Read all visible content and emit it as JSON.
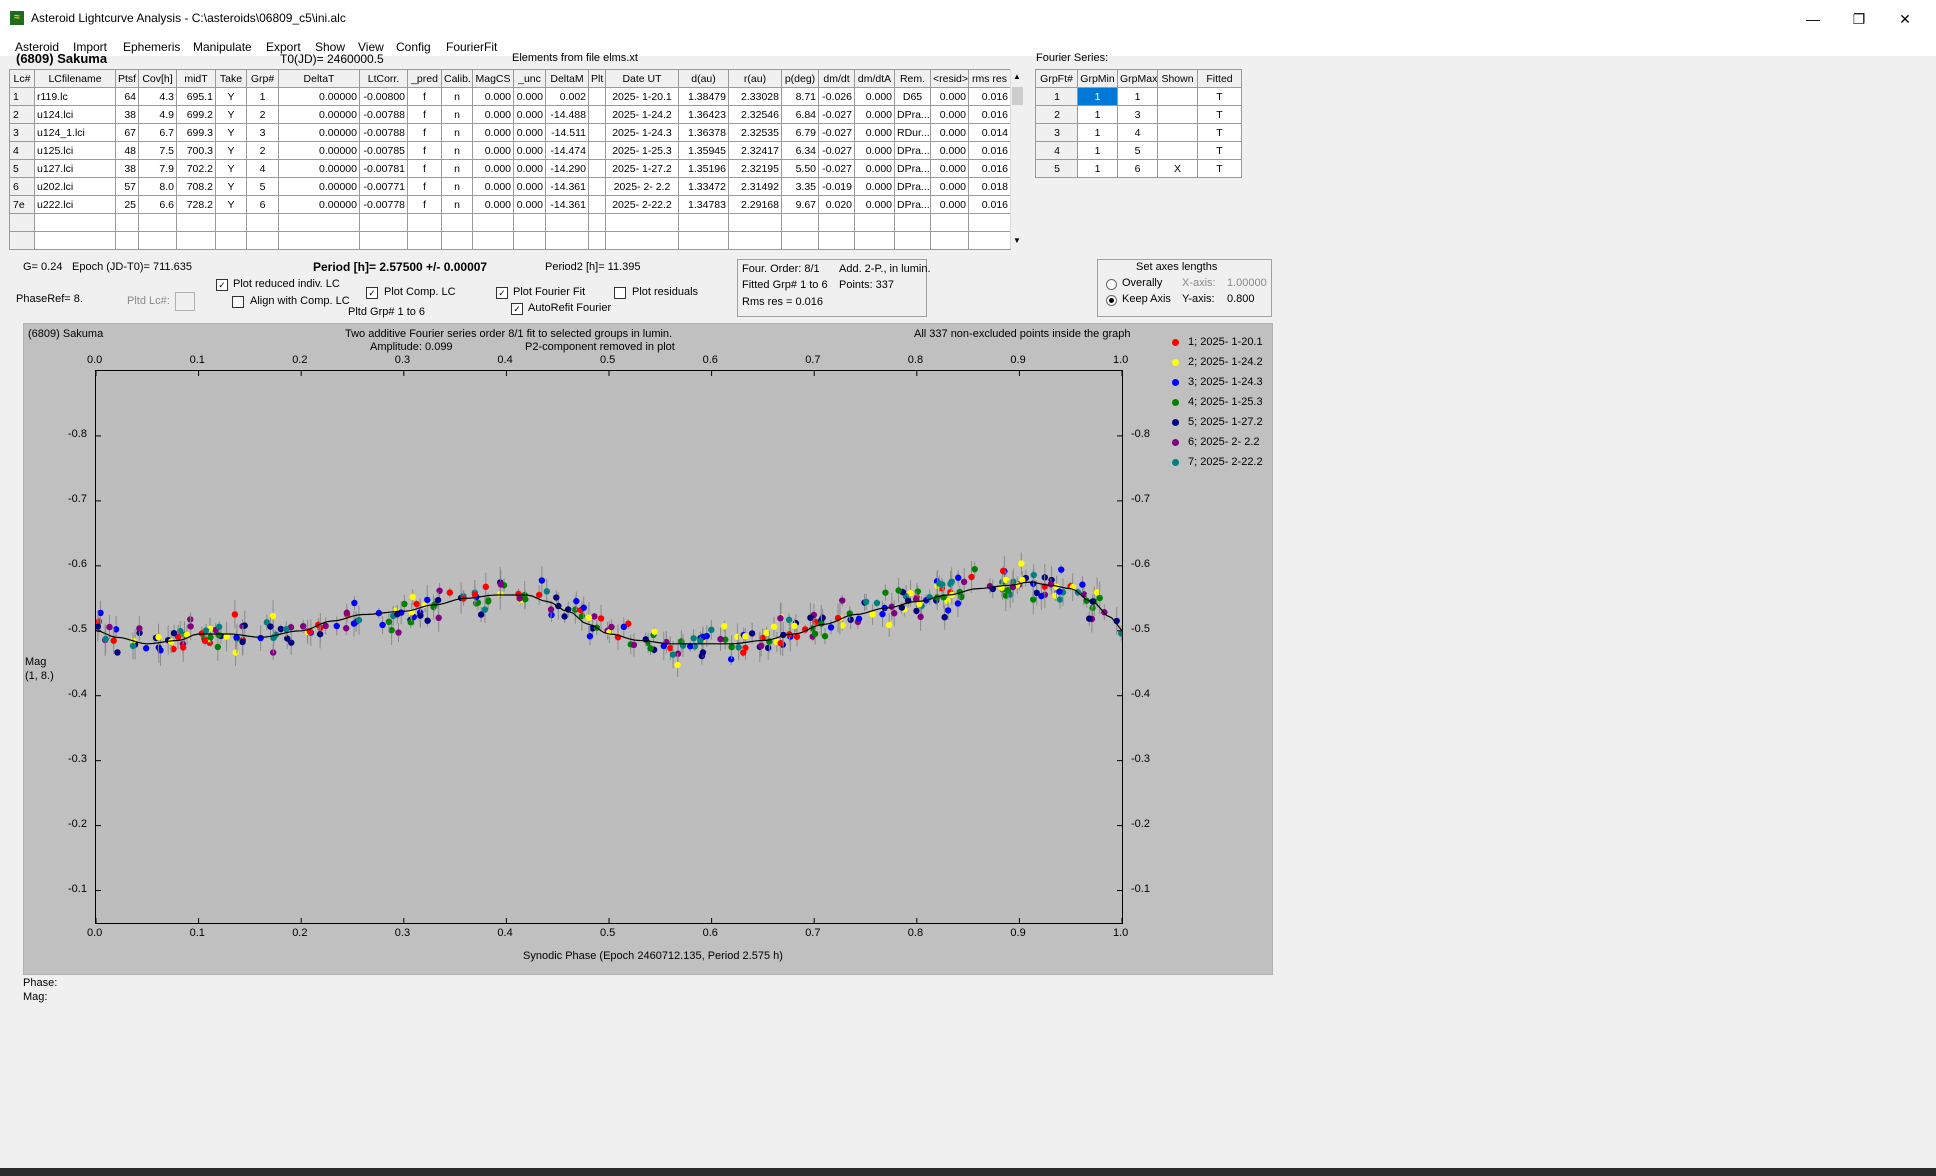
{
  "window": {
    "title": "Asteroid Lightcurve Analysis - C:\\asteroids\\06809_c5\\ini.alc",
    "minimize": "—",
    "maximize": "❐",
    "close": "✕"
  },
  "menu": [
    "Asteroid",
    "Import",
    "Ephemeris",
    "Manipulate",
    "Export",
    "Show",
    "View",
    "Config",
    "FourierFit"
  ],
  "header": {
    "asteroid": "(6809) Sakuma",
    "t0": "T0(JD)= 2460000.5",
    "elements": "Elements from file elms.xt"
  },
  "lc_table": {
    "columns": [
      "Lc#",
      "LCfilename",
      "Ptsf",
      "Cov[h]",
      "midT",
      "Take",
      "Grp#",
      "DeltaT",
      "LtCorr.",
      "_pred",
      "Calib.",
      "MagCS",
      "_unc",
      "DeltaM",
      "Plt",
      "Date UT",
      "d(au)",
      "r(au)",
      "p(deg)",
      "dm/dt",
      "dm/dtA",
      "Rem.",
      "<resid>",
      "rms res"
    ],
    "rows": [
      [
        "1",
        "r119.lc",
        "64",
        "4.3",
        "695.1",
        "Y",
        "1",
        "0.00000",
        "-0.00800",
        "f",
        "n",
        "0.000",
        "0.000",
        "0.002",
        "",
        "2025- 1-20.1",
        "1.38479",
        "2.33028",
        "8.71",
        "-0.026",
        "0.000",
        "D65",
        "0.000",
        "0.016"
      ],
      [
        "2",
        "u124.lci",
        "38",
        "4.9",
        "699.2",
        "Y",
        "2",
        "0.00000",
        "-0.00788",
        "f",
        "n",
        "0.000",
        "0.000",
        "-14.488",
        "",
        "2025- 1-24.2",
        "1.36423",
        "2.32546",
        "6.84",
        "-0.027",
        "0.000",
        "DPra...",
        "0.000",
        "0.016"
      ],
      [
        "3",
        "u124_1.lci",
        "67",
        "6.7",
        "699.3",
        "Y",
        "3",
        "0.00000",
        "-0.00788",
        "f",
        "n",
        "0.000",
        "0.000",
        "-14.511",
        "",
        "2025- 1-24.3",
        "1.36378",
        "2.32535",
        "6.79",
        "-0.027",
        "0.000",
        "RDur...",
        "0.000",
        "0.014"
      ],
      [
        "4",
        "u125.lci",
        "48",
        "7.5",
        "700.3",
        "Y",
        "2",
        "0.00000",
        "-0.00785",
        "f",
        "n",
        "0.000",
        "0.000",
        "-14.474",
        "",
        "2025- 1-25.3",
        "1.35945",
        "2.32417",
        "6.34",
        "-0.027",
        "0.000",
        "DPra...",
        "0.000",
        "0.016"
      ],
      [
        "5",
        "u127.lci",
        "38",
        "7.9",
        "702.2",
        "Y",
        "4",
        "0.00000",
        "-0.00781",
        "f",
        "n",
        "0.000",
        "0.000",
        "-14.290",
        "",
        "2025- 1-27.2",
        "1.35196",
        "2.32195",
        "5.50",
        "-0.027",
        "0.000",
        "DPra...",
        "0.000",
        "0.016"
      ],
      [
        "6",
        "u202.lci",
        "57",
        "8.0",
        "708.2",
        "Y",
        "5",
        "0.00000",
        "-0.00771",
        "f",
        "n",
        "0.000",
        "0.000",
        "-14.361",
        "",
        "2025- 2- 2.2",
        "1.33472",
        "2.31492",
        "3.35",
        "-0.019",
        "0.000",
        "DPra...",
        "0.000",
        "0.018"
      ],
      [
        "7e",
        "u222.lci",
        "25",
        "6.6",
        "728.2",
        "Y",
        "6",
        "0.00000",
        "-0.00778",
        "f",
        "n",
        "0.000",
        "0.000",
        "-14.361",
        "",
        "2025- 2-22.2",
        "1.34783",
        "2.29168",
        "9.67",
        "0.020",
        "0.000",
        "DPra...",
        "0.000",
        "0.016"
      ]
    ]
  },
  "fourier_table": {
    "title": "Fourier Series:",
    "columns": [
      "GrpFt#",
      "GrpMin",
      "GrpMax",
      "Shown",
      "Fitted"
    ],
    "rows": [
      [
        "1",
        "1",
        "1",
        "",
        "T"
      ],
      [
        "2",
        "1",
        "3",
        "",
        "T"
      ],
      [
        "3",
        "1",
        "4",
        "",
        "T"
      ],
      [
        "4",
        "1",
        "5",
        "",
        "T"
      ],
      [
        "5",
        "1",
        "6",
        "X",
        "T"
      ]
    ]
  },
  "controls": {
    "g": "G= 0.24",
    "epoch": "Epoch (JD-T0)= 711.635",
    "period": "Period [h]= 2.57500 +/- 0.00007",
    "period2": "Period2 [h]= 11.395",
    "phaseref": "PhaseRef= 8.",
    "pltd_lc": "Pltd Lc#:",
    "plot_reduced": "Plot reduced indiv. LC",
    "align_comp": "Align with Comp. LC",
    "plot_comp": "Plot Comp. LC",
    "pltd_grp": "Pltd Grp#  1   to   6",
    "plot_fourier": "Plot Fourier Fit",
    "autorefit": "AutoRefit Fourier",
    "plot_residuals": "Plot residuals",
    "four_order": "Four. Order:  8/1",
    "add2p": "Add. 2-P., in lumin.",
    "fitted_grp": "Fitted Grp# 1 to 6",
    "points": "Points:  337",
    "rms_res": "Rms res      = 0.016",
    "axes_title": "Set axes lengths",
    "overally": "Overally",
    "keep_axis": "Keep Axis",
    "xaxis_label": "X-axis:",
    "xaxis_val": "1.00000",
    "yaxis_label": "Y-axis:",
    "yaxis_val": "0.800",
    "checkmark": "✓"
  },
  "plot": {
    "name": "(6809) Sakuma",
    "line1": "Two additive Fourier series order 8/1 fit to selected groups in lumin.",
    "amplitude": "Amplitude: 0.099",
    "p2": "P2-component removed in plot",
    "inside": "All 337 non-excluded points inside the graph",
    "ylabel1": "Mag",
    "ylabel2": "(1, 8.)",
    "xlabel": "Synodic Phase (Epoch 2460712.135, Period 2.575 h)"
  },
  "status": {
    "phase": "Phase:",
    "mag": "Mag:"
  },
  "chart_data": {
    "type": "scatter",
    "x_ticks": [
      "0.0",
      "0.1",
      "0.2",
      "0.3",
      "0.4",
      "0.5",
      "0.6",
      "0.7",
      "0.8",
      "0.9",
      "1.0"
    ],
    "y_ticks": [
      "-0.8",
      "-0.7",
      "-0.6",
      "-0.5",
      "-0.4",
      "-0.3",
      "-0.2",
      "-0.1"
    ],
    "xlim": [
      0,
      1
    ],
    "ylim": [
      -0.9,
      -0.05
    ],
    "series": [
      {
        "name": "1; 2025- 1-20.1",
        "color": "#ff0000"
      },
      {
        "name": "2; 2025- 1-24.2",
        "color": "#ffff00"
      },
      {
        "name": "3; 2025- 1-24.3",
        "color": "#0000ff"
      },
      {
        "name": "4; 2025- 1-25.3",
        "color": "#008000"
      },
      {
        "name": "5; 2025- 1-27.2",
        "color": "#000080"
      },
      {
        "name": "6; 2025- 2- 2.2",
        "color": "#800080"
      },
      {
        "name": "7; 2025- 2-22.2",
        "color": "#008080"
      }
    ],
    "fit_curve": {
      "x": [
        0.0,
        0.02,
        0.05,
        0.08,
        0.1,
        0.13,
        0.16,
        0.2,
        0.23,
        0.26,
        0.3,
        0.33,
        0.36,
        0.39,
        0.42,
        0.44,
        0.46,
        0.48,
        0.5,
        0.53,
        0.56,
        0.59,
        0.62,
        0.65,
        0.68,
        0.71,
        0.74,
        0.77,
        0.8,
        0.83,
        0.86,
        0.89,
        0.91,
        0.93,
        0.95,
        0.97,
        0.99,
        1.0
      ],
      "y": [
        -0.5,
        -0.49,
        -0.48,
        -0.485,
        -0.495,
        -0.495,
        -0.49,
        -0.5,
        -0.515,
        -0.525,
        -0.53,
        -0.54,
        -0.55,
        -0.555,
        -0.555,
        -0.545,
        -0.53,
        -0.51,
        -0.495,
        -0.485,
        -0.48,
        -0.48,
        -0.48,
        -0.485,
        -0.495,
        -0.51,
        -0.525,
        -0.535,
        -0.545,
        -0.555,
        -0.565,
        -0.57,
        -0.575,
        -0.57,
        -0.565,
        -0.545,
        -0.52,
        -0.5
      ]
    }
  }
}
